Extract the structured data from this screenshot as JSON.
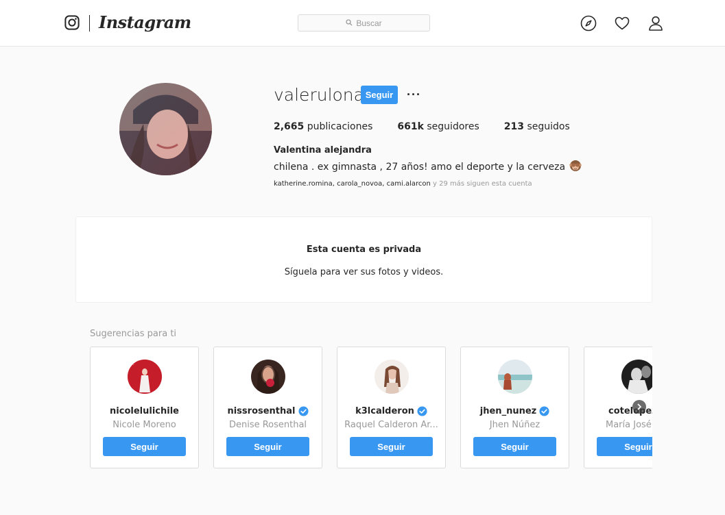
{
  "header": {
    "wordmark": "Instagram",
    "search_placeholder": "Buscar",
    "icons": [
      "instagram-glyph-icon",
      "search-icon",
      "compass-icon",
      "heart-icon",
      "person-icon"
    ]
  },
  "profile": {
    "username": "valerulona",
    "follow_label": "Seguir",
    "more_label": "···",
    "stats": {
      "posts_count": "2,665",
      "posts_label": "publicaciones",
      "followers_count": "661k",
      "followers_label": "seguidores",
      "following_count": "213",
      "following_label": "seguidos"
    },
    "full_name": "Valentina alejandra",
    "bio": "chilena . ex gimnasta , 27 años! amo el deporte y la cerveza",
    "bio_emoji": "see-no-evil-monkey-icon",
    "followed_by": {
      "user1": "katherine.romina",
      "sep1": ",",
      "user2": "carola_novoa",
      "sep2": ",",
      "user3": "cami.alarcon",
      "rest": "y 29 más siguen esta cuenta"
    }
  },
  "private": {
    "title": "Esta cuenta es privada",
    "subtitle": "Síguela para ver sus fotos y videos."
  },
  "suggestions": {
    "title": "Sugerencias para ti",
    "items": [
      {
        "handle": "nicolelulichile",
        "name": "Nicole Moreno",
        "verified": false,
        "button": "Seguir"
      },
      {
        "handle": "nissrosenthal",
        "name": "Denise Rosenthal",
        "verified": true,
        "button": "Seguir"
      },
      {
        "handle": "k3lcalderon",
        "name": "Raquel Calderon Ar...",
        "verified": true,
        "button": "Seguir"
      },
      {
        "handle": "jhen_nunez",
        "name": "Jhen Núñez",
        "verified": true,
        "button": "Seguir"
      },
      {
        "handle": "cotelopezm",
        "name": "María José L",
        "verified": false,
        "button": "Seguir"
      }
    ]
  },
  "colors": {
    "accent": "#3897f0",
    "background": "#fafafa",
    "muted": "#999999",
    "text": "#262626"
  }
}
